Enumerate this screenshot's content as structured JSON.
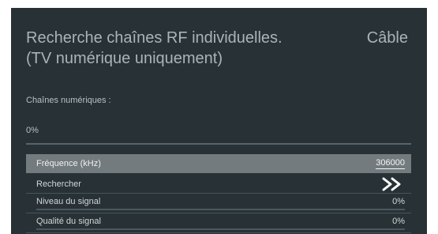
{
  "header": {
    "title": "Recherche chaînes RF individuelles. (TV numérique uniquement)",
    "signal_type": "Câble"
  },
  "scan": {
    "channels_label": "Chaînes numériques :",
    "progress_text": "0%",
    "progress_fraction": 0
  },
  "rows": {
    "frequency": {
      "label": "Fréquence (kHz)",
      "value": "306000"
    },
    "search": {
      "label": "Rechercher",
      "icon": "double-chevron-right-icon"
    },
    "signal_level": {
      "label": "Niveau du signal",
      "value": "0%",
      "fraction": 0
    },
    "signal_quality": {
      "label": "Qualité du signal",
      "value": "0%",
      "fraction": 0
    }
  },
  "colors": {
    "background": "#283236",
    "highlight": "#737b7e",
    "text": "#aab3b6"
  }
}
